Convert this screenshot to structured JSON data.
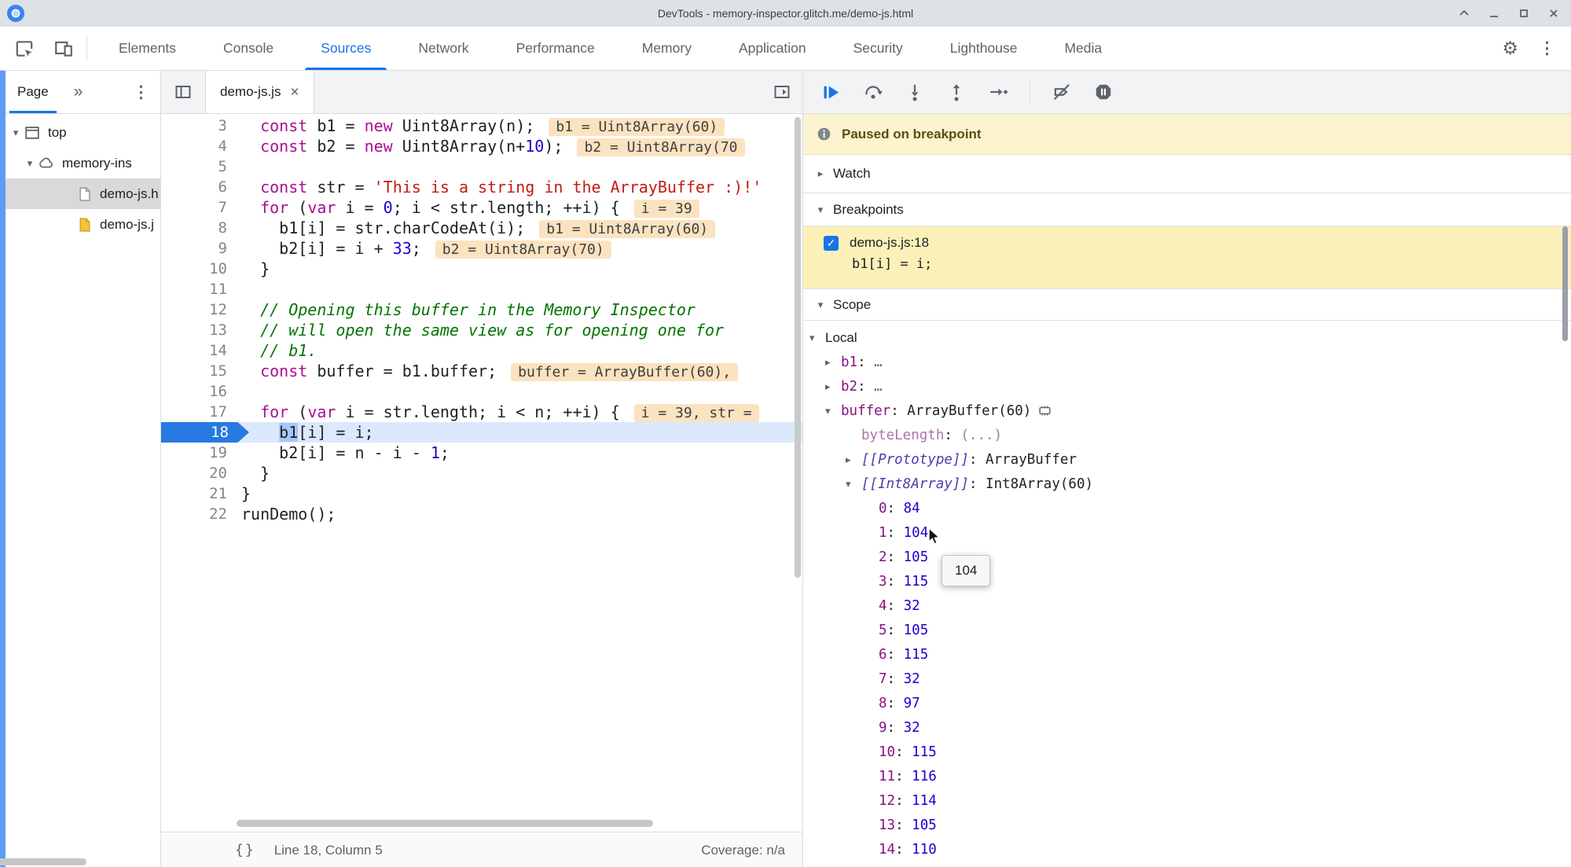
{
  "window": {
    "title": "DevTools - memory-inspector.glitch.me/demo-js.html",
    "controls": [
      "expand-icon",
      "minimize-icon",
      "maximize-icon",
      "close-icon"
    ]
  },
  "colors": {
    "accent_blue": "#1a73e8",
    "paused_bar_bg": "#fcf3cf",
    "breakpoint_item_bg": "#fbf1b8",
    "execution_line_bg": "#dce9fc",
    "inline_badge_bg": "#fbe3c0",
    "selection_blue": "#a8c7f8",
    "property_purple": "#881280",
    "number_blue": "#1c00cf",
    "string_red": "#c41a16",
    "keyword_magenta": "#aa0d91",
    "comment_green": "#007400"
  },
  "main_toolbar": {
    "left_icons": [
      "inspect-icon",
      "device-toolbar-icon"
    ],
    "tabs": [
      {
        "label": "Elements"
      },
      {
        "label": "Console"
      },
      {
        "label": "Sources",
        "active": true
      },
      {
        "label": "Network"
      },
      {
        "label": "Performance"
      },
      {
        "label": "Memory"
      },
      {
        "label": "Application"
      },
      {
        "label": "Security"
      },
      {
        "label": "Lighthouse"
      },
      {
        "label": "Media"
      }
    ],
    "right_icons": [
      "settings-gear-icon",
      "kebab-menu-icon"
    ]
  },
  "sidebar": {
    "tab_label": "Page",
    "header_icons": [
      "more-tabs-icon",
      "kebab-menu-icon"
    ],
    "tree": [
      {
        "label": "top",
        "icon": "frame-icon",
        "arrow": "down",
        "pad": 10
      },
      {
        "label": "memory-ins",
        "icon": "cloud-icon",
        "arrow": "down",
        "pad": 28
      },
      {
        "label": "demo-js.h",
        "icon": "file-html-icon",
        "arrow": "none",
        "pad": 78,
        "selected": true
      },
      {
        "label": "demo-js.j",
        "icon": "file-js-icon",
        "arrow": "none",
        "pad": 78
      }
    ]
  },
  "editor": {
    "nav_icon": "toggle-navigator-icon",
    "tab": {
      "label": "demo-js.js",
      "close": "×"
    },
    "corner_icon": "open-drawer-icon",
    "lines": [
      {
        "n": 3,
        "tokens": [
          [
            "pl",
            "  "
          ],
          [
            "kw",
            "const"
          ],
          [
            "pl",
            " b1 = "
          ],
          [
            "kw",
            "new"
          ],
          [
            "pl",
            " Uint8Array(n);"
          ]
        ],
        "badge": "b1 = Uint8Array(60)"
      },
      {
        "n": 4,
        "tokens": [
          [
            "pl",
            "  "
          ],
          [
            "kw",
            "const"
          ],
          [
            "pl",
            " b2 = "
          ],
          [
            "kw",
            "new"
          ],
          [
            "pl",
            " Uint8Array(n+"
          ],
          [
            "num",
            "10"
          ],
          [
            "pl",
            ");"
          ]
        ],
        "badge": "b2 = Uint8Array(70"
      },
      {
        "n": 5,
        "tokens": []
      },
      {
        "n": 6,
        "tokens": [
          [
            "pl",
            "  "
          ],
          [
            "kw",
            "const"
          ],
          [
            "pl",
            " str = "
          ],
          [
            "str",
            "'This is a string in the ArrayBuffer :)!'"
          ]
        ]
      },
      {
        "n": 7,
        "tokens": [
          [
            "pl",
            "  "
          ],
          [
            "kw",
            "for"
          ],
          [
            "pl",
            " ("
          ],
          [
            "kw",
            "var"
          ],
          [
            "pl",
            " i = "
          ],
          [
            "num",
            "0"
          ],
          [
            "pl",
            "; i < str.length; ++i) {"
          ]
        ],
        "badge": "i = 39"
      },
      {
        "n": 8,
        "tokens": [
          [
            "pl",
            "    b1[i] = str.charCodeAt(i);"
          ]
        ],
        "badge": "b1 = Uint8Array(60)"
      },
      {
        "n": 9,
        "tokens": [
          [
            "pl",
            "    b2[i] = i + "
          ],
          [
            "num",
            "33"
          ],
          [
            "pl",
            ";"
          ]
        ],
        "badge": "b2 = Uint8Array(70)"
      },
      {
        "n": 10,
        "tokens": [
          [
            "pl",
            "  }"
          ]
        ]
      },
      {
        "n": 11,
        "tokens": []
      },
      {
        "n": 12,
        "tokens": [
          [
            "com",
            "  // Opening this buffer in the Memory Inspector"
          ]
        ]
      },
      {
        "n": 13,
        "tokens": [
          [
            "com",
            "  // will open the same view as for opening one for"
          ]
        ]
      },
      {
        "n": 14,
        "tokens": [
          [
            "com",
            "  // b1."
          ]
        ]
      },
      {
        "n": 15,
        "tokens": [
          [
            "pl",
            "  "
          ],
          [
            "kw",
            "const"
          ],
          [
            "pl",
            " buffer = b1.buffer;"
          ]
        ],
        "badge": "buffer = ArrayBuffer(60),"
      },
      {
        "n": 16,
        "tokens": []
      },
      {
        "n": 17,
        "tokens": [
          [
            "pl",
            "  "
          ],
          [
            "kw",
            "for"
          ],
          [
            "pl",
            " ("
          ],
          [
            "kw",
            "var"
          ],
          [
            "pl",
            " i = str.length; i < n; ++i) {"
          ]
        ],
        "badge": "i = 39, str ="
      },
      {
        "n": 18,
        "current": true,
        "tokens": [
          [
            "pl",
            "    "
          ],
          [
            "sel",
            "b1"
          ],
          [
            "pl",
            "[i] = i;"
          ]
        ]
      },
      {
        "n": 19,
        "tokens": [
          [
            "pl",
            "    b2[i] = n - i - "
          ],
          [
            "num",
            "1"
          ],
          [
            "pl",
            ";"
          ]
        ]
      },
      {
        "n": 20,
        "tokens": [
          [
            "pl",
            "  }"
          ]
        ]
      },
      {
        "n": 21,
        "tokens": [
          [
            "pl",
            "}"
          ]
        ]
      },
      {
        "n": 22,
        "tokens": [
          [
            "pl",
            "runDemo();"
          ]
        ]
      }
    ],
    "status": {
      "format_label": "{}",
      "line_col": "Line 18, Column 5",
      "coverage": "Coverage: n/a"
    }
  },
  "debugger": {
    "toolbar": [
      "resume-icon",
      "step-over-icon",
      "step-into-icon",
      "step-out-icon",
      "step-icon",
      "deactivate-breakpoints-icon",
      "pause-on-exceptions-icon"
    ],
    "paused_message": "Paused on breakpoint",
    "watch_label": "Watch",
    "breakpoints_label": "Breakpoints",
    "breakpoint": {
      "checked": true,
      "location": "demo-js.js:18",
      "code": "b1[i] = i;"
    },
    "scope_label": "Scope",
    "scope_rows": [
      {
        "lvl": 0,
        "arrow": "down",
        "name": "Local",
        "nc": "n-local",
        "value": "",
        "vc": ""
      },
      {
        "lvl": 1,
        "arrow": "right",
        "name": "b1",
        "nc": "n-purple",
        "value": "…",
        "vc": "v-dots"
      },
      {
        "lvl": 1,
        "arrow": "right",
        "name": "b2",
        "nc": "n-purple",
        "value": "…",
        "vc": "v-dots"
      },
      {
        "lvl": 1,
        "arrow": "down",
        "name": "buffer",
        "nc": "n-purple",
        "value": "ArrayBuffer(60)",
        "vc": "v-obj",
        "icon": "memory-inspector-icon"
      },
      {
        "lvl": 2,
        "arrow": "none",
        "name": "byteLength",
        "nc": "n-getter",
        "value": "(...)",
        "vc": "v-getter"
      },
      {
        "lvl": 2,
        "arrow": "right",
        "name": "[[Prototype]]",
        "nc": "n-internal",
        "value": "ArrayBuffer",
        "vc": "v-obj"
      },
      {
        "lvl": 2,
        "arrow": "down",
        "name": "[[Int8Array]]",
        "nc": "n-internal",
        "value": "Int8Array(60)",
        "vc": "v-obj"
      },
      {
        "lvl": 3,
        "arrow": "none",
        "name": "0",
        "nc": "n-purple",
        "value": "84",
        "vc": "v-num"
      },
      {
        "lvl": 3,
        "arrow": "none",
        "name": "1",
        "nc": "n-purple",
        "value": "104",
        "vc": "v-num"
      },
      {
        "lvl": 3,
        "arrow": "none",
        "name": "2",
        "nc": "n-purple",
        "value": "105",
        "vc": "v-num"
      },
      {
        "lvl": 3,
        "arrow": "none",
        "name": "3",
        "nc": "n-purple",
        "value": "115",
        "vc": "v-num"
      },
      {
        "lvl": 3,
        "arrow": "none",
        "name": "4",
        "nc": "n-purple",
        "value": "32",
        "vc": "v-num"
      },
      {
        "lvl": 3,
        "arrow": "none",
        "name": "5",
        "nc": "n-purple",
        "value": "105",
        "vc": "v-num"
      },
      {
        "lvl": 3,
        "arrow": "none",
        "name": "6",
        "nc": "n-purple",
        "value": "115",
        "vc": "v-num"
      },
      {
        "lvl": 3,
        "arrow": "none",
        "name": "7",
        "nc": "n-purple",
        "value": "32",
        "vc": "v-num"
      },
      {
        "lvl": 3,
        "arrow": "none",
        "name": "8",
        "nc": "n-purple",
        "value": "97",
        "vc": "v-num"
      },
      {
        "lvl": 3,
        "arrow": "none",
        "name": "9",
        "nc": "n-purple",
        "value": "32",
        "vc": "v-num"
      },
      {
        "lvl": 3,
        "arrow": "none",
        "name": "10",
        "nc": "n-purple",
        "value": "115",
        "vc": "v-num"
      },
      {
        "lvl": 3,
        "arrow": "none",
        "name": "11",
        "nc": "n-purple",
        "value": "116",
        "vc": "v-num"
      },
      {
        "lvl": 3,
        "arrow": "none",
        "name": "12",
        "nc": "n-purple",
        "value": "114",
        "vc": "v-num"
      },
      {
        "lvl": 3,
        "arrow": "none",
        "name": "13",
        "nc": "n-purple",
        "value": "105",
        "vc": "v-num"
      },
      {
        "lvl": 3,
        "arrow": "none",
        "name": "14",
        "nc": "n-purple",
        "value": "110",
        "vc": "v-num"
      }
    ],
    "tooltip": "104"
  }
}
